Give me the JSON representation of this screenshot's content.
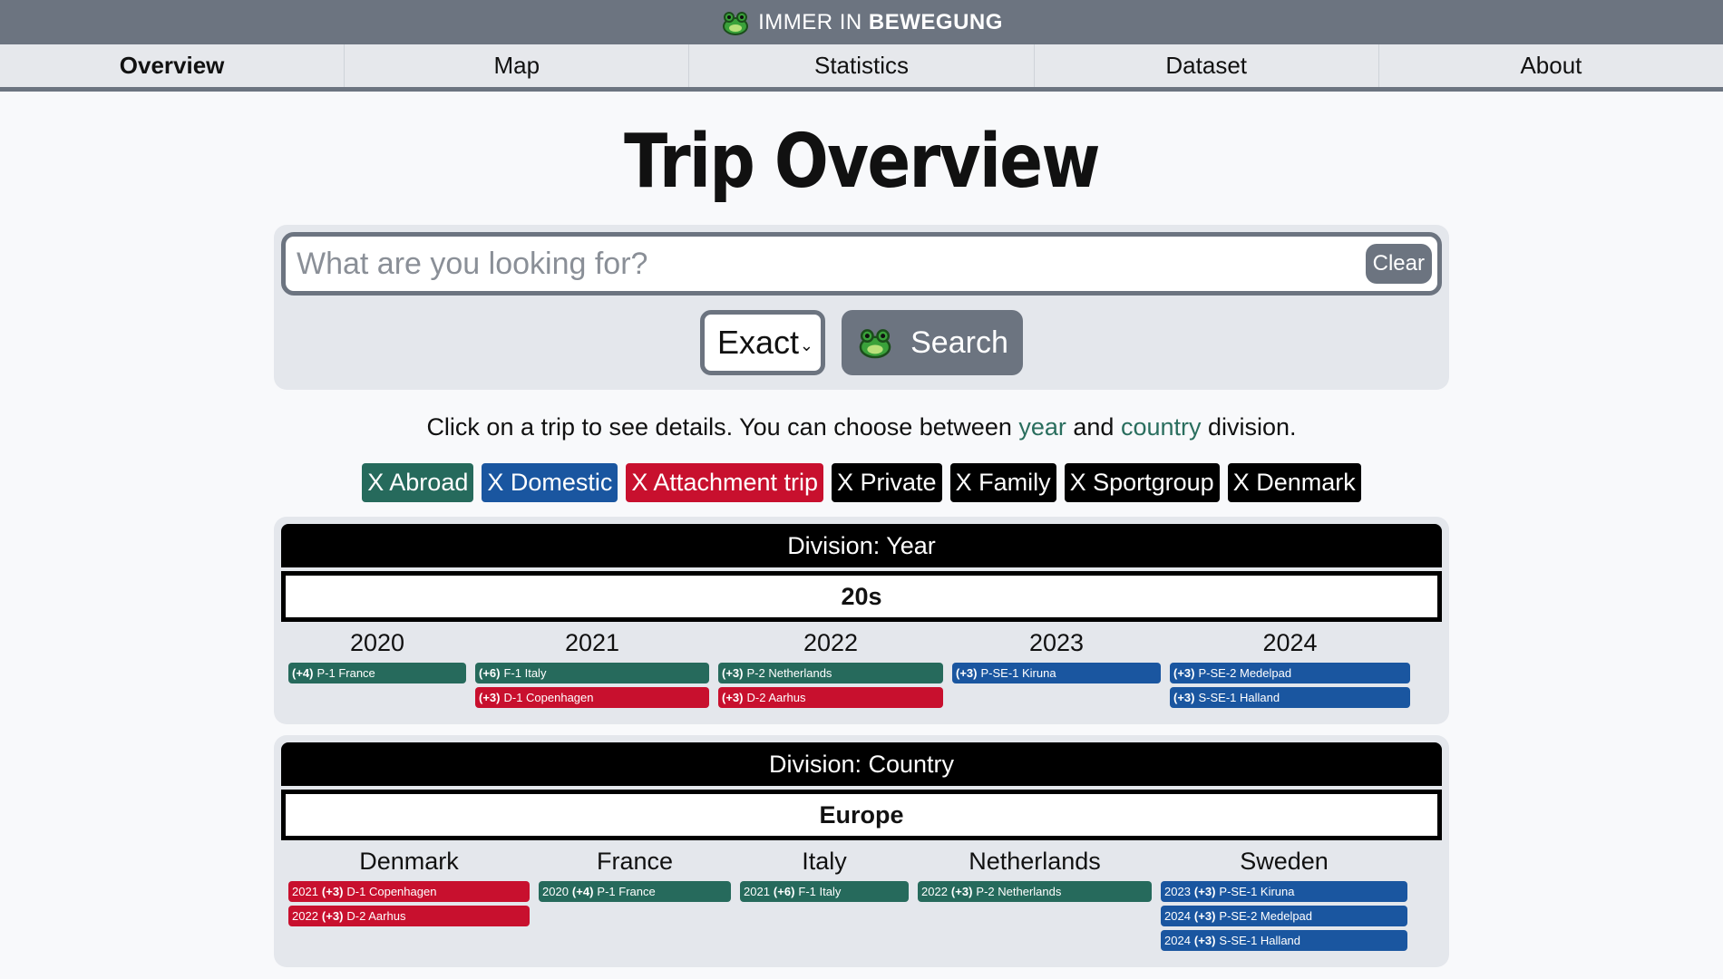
{
  "brand": {
    "prefix": "IMMER IN",
    "bold": "BEWEGUNG"
  },
  "nav": [
    {
      "label": "Overview",
      "active": true
    },
    {
      "label": "Map"
    },
    {
      "label": "Statistics"
    },
    {
      "label": "Dataset"
    },
    {
      "label": "About"
    }
  ],
  "title": "Trip Overview",
  "search": {
    "placeholder": "What are you looking for?",
    "clear": "Clear",
    "mode": "Exact",
    "button": "Search"
  },
  "hint": {
    "before": "Click on a trip to see details. You can choose between ",
    "year": "year",
    "mid": " and ",
    "country": "country",
    "after": " division."
  },
  "filters": [
    {
      "label": "X Abroad",
      "color": "green"
    },
    {
      "label": "X Domestic",
      "color": "blue"
    },
    {
      "label": "X Attachment trip",
      "color": "red"
    },
    {
      "label": "X Private",
      "color": "black"
    },
    {
      "label": "X Family",
      "color": "black"
    },
    {
      "label": "X Sportgroup",
      "color": "black"
    },
    {
      "label": "X Denmark",
      "color": "black"
    }
  ],
  "colors": {
    "green": "#266a5c",
    "blue": "#1a56a0",
    "red": "#c8102e",
    "black": "#000000"
  },
  "year_division": {
    "header": "Division: Year",
    "group": "20s",
    "columns": [
      {
        "heading": "2020",
        "trips": [
          {
            "count": "(+4)",
            "label": "P-1 France",
            "color": "green"
          }
        ]
      },
      {
        "heading": "2021",
        "trips": [
          {
            "count": "(+6)",
            "label": "F-1 Italy",
            "color": "green"
          },
          {
            "count": "(+3)",
            "label": "D-1 Copenhagen",
            "color": "red"
          }
        ]
      },
      {
        "heading": "2022",
        "trips": [
          {
            "count": "(+3)",
            "label": "P-2 Netherlands",
            "color": "green"
          },
          {
            "count": "(+3)",
            "label": "D-2 Aarhus",
            "color": "red"
          }
        ]
      },
      {
        "heading": "2023",
        "trips": [
          {
            "count": "(+3)",
            "label": "P-SE-1 Kiruna",
            "color": "blue"
          }
        ]
      },
      {
        "heading": "2024",
        "trips": [
          {
            "count": "(+3)",
            "label": "P-SE-2 Medelpad",
            "color": "blue"
          },
          {
            "count": "(+3)",
            "label": "S-SE-1 Halland",
            "color": "blue"
          }
        ]
      }
    ]
  },
  "country_division": {
    "header": "Division: Country",
    "group": "Europe",
    "columns": [
      {
        "heading": "Denmark",
        "trips": [
          {
            "year": "2021",
            "count": "(+3)",
            "label": "D-1 Copenhagen",
            "color": "red"
          },
          {
            "year": "2022",
            "count": "(+3)",
            "label": "D-2 Aarhus",
            "color": "red"
          }
        ]
      },
      {
        "heading": "France",
        "trips": [
          {
            "year": "2020",
            "count": "(+4)",
            "label": "P-1 France",
            "color": "green"
          }
        ]
      },
      {
        "heading": "Italy",
        "trips": [
          {
            "year": "2021",
            "count": "(+6)",
            "label": "F-1 Italy",
            "color": "green"
          }
        ]
      },
      {
        "heading": "Netherlands",
        "trips": [
          {
            "year": "2022",
            "count": "(+3)",
            "label": "P-2 Netherlands",
            "color": "green"
          }
        ]
      },
      {
        "heading": "Sweden",
        "trips": [
          {
            "year": "2023",
            "count": "(+3)",
            "label": "P-SE-1 Kiruna",
            "color": "blue"
          },
          {
            "year": "2024",
            "count": "(+3)",
            "label": "P-SE-2 Medelpad",
            "color": "blue"
          },
          {
            "year": "2024",
            "count": "(+3)",
            "label": "S-SE-1 Halland",
            "color": "blue"
          }
        ]
      }
    ]
  }
}
